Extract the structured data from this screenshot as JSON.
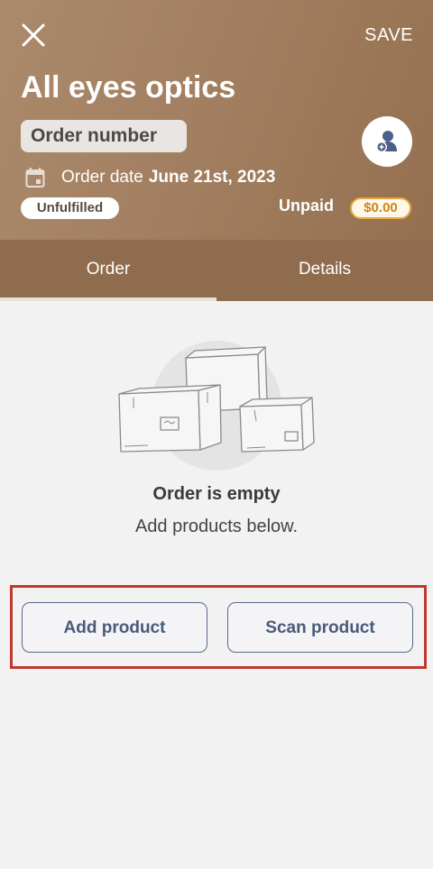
{
  "header": {
    "save_label": "SAVE",
    "title": "All eyes optics",
    "order_number_label": "Order number",
    "date_label": "Order date",
    "date_value": "June 21st, 2023",
    "fulfillment_status": "Unfulfilled",
    "payment_status": "Unpaid",
    "amount": "$0.00",
    "icons": {
      "close": "close-icon",
      "customer": "add-customer-icon",
      "calendar": "calendar-icon"
    }
  },
  "tabs": [
    {
      "label": "Order",
      "active": true
    },
    {
      "label": "Details",
      "active": false
    }
  ],
  "empty_state": {
    "title": "Order is empty",
    "subtitle": "Add products below."
  },
  "actions": {
    "add_label": "Add product",
    "scan_label": "Scan product"
  },
  "colors": {
    "header_brown": "#a17e5f",
    "tab_bar_brown": "#8f6c4d",
    "button_text": "#4a5a7a",
    "amount_orange": "#e9a83c",
    "highlight_red": "#c0392b"
  }
}
